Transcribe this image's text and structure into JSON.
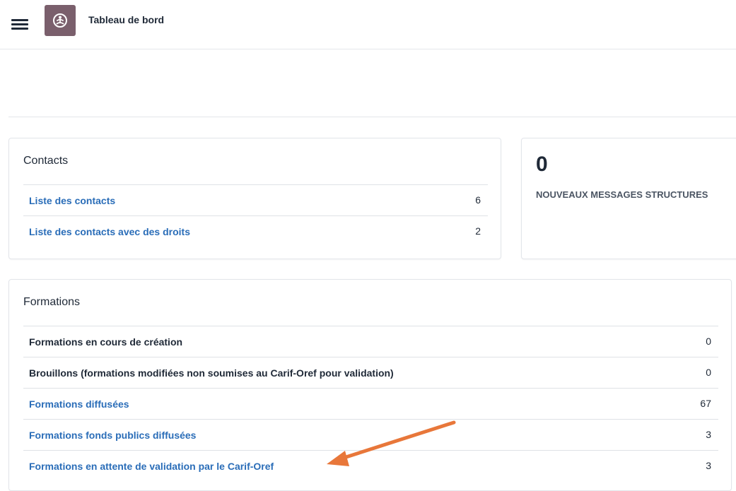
{
  "header": {
    "title": "Tableau de bord",
    "menu_icon": "hamburger-menu-icon",
    "logo_icon": "meditation-logo-icon",
    "logo_color": "#7a5f6c"
  },
  "contacts": {
    "title": "Contacts",
    "items": [
      {
        "label": "Liste des contacts",
        "count": "6"
      },
      {
        "label": "Liste des contacts avec des droits",
        "count": "2"
      }
    ]
  },
  "messages": {
    "count": "0",
    "label": "NOUVEAUX MESSAGES STRUCTURES"
  },
  "formations": {
    "title": "Formations",
    "items": [
      {
        "label": "Formations en cours de création",
        "count": "0"
      },
      {
        "label": "Brouillons (formations modifiées non soumises au Carif-Oref pour validation)",
        "count": "0"
      },
      {
        "label": "Formations diffusées",
        "count": "67"
      },
      {
        "label": "Formations fonds publics diffusées",
        "count": "3"
      },
      {
        "label": "Formations en attente de validation par le Carif-Oref",
        "count": "3"
      }
    ]
  },
  "colors": {
    "link": "#2a6db8",
    "annotation_arrow": "#e8773a"
  }
}
